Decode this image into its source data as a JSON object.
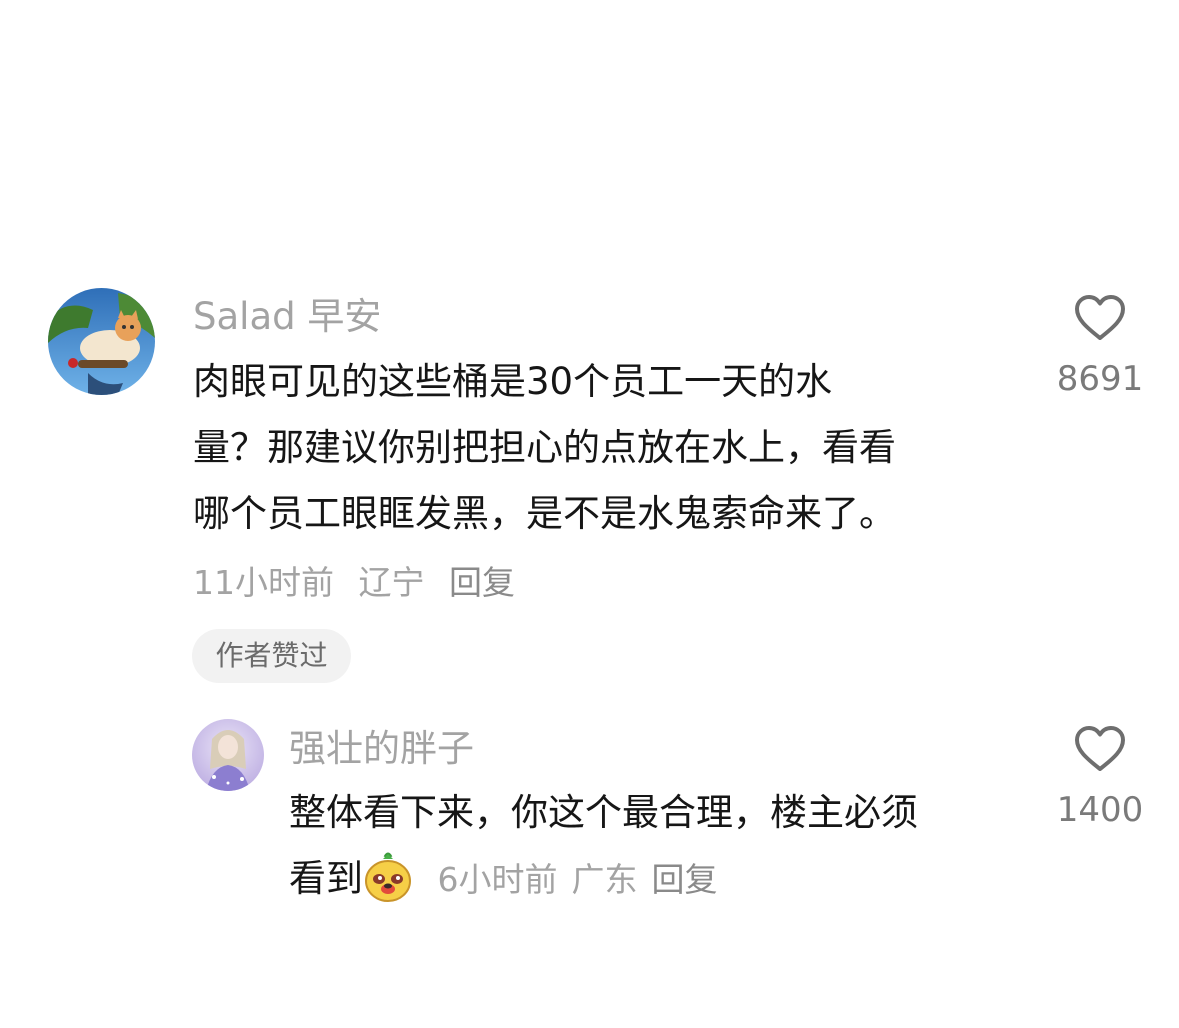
{
  "comment": {
    "username": "Salad 早安",
    "lines": [
      "肉眼可见的这些桶是30个员工一天的水",
      "量？那建议你别把担心的点放在水上，看看",
      "哪个员工眼眶发黑，是不是水鬼索命来了。"
    ],
    "time": "11小时前",
    "location": "辽宁",
    "reply_label": "回复",
    "badge": "作者赞过",
    "like_count": "8691"
  },
  "reply": {
    "username": "强壮的胖子",
    "lines": [
      "整体看下来，你这个最合理，楼主必须",
      "看到"
    ],
    "emoji": "doge-face-emoji",
    "time": "6小时前",
    "location": "广东",
    "reply_label": "回复",
    "like_count": "1400"
  },
  "colors": {
    "username": "#a3a3a3",
    "text": "#161616",
    "meta": "#a3a3a3",
    "badge_bg": "#f2f2f2",
    "heart": "#6e6e6e"
  }
}
